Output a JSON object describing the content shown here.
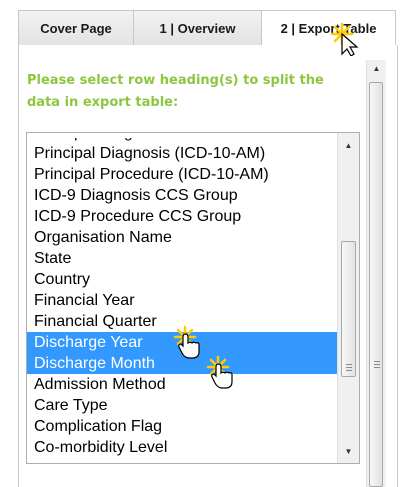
{
  "tabs": [
    {
      "label": "Cover Page"
    },
    {
      "label": "1 | Overview"
    },
    {
      "label": "2 | Export Table"
    }
  ],
  "prompt": "Please select row heading(s) to split the data in export table:",
  "list": {
    "items": [
      {
        "label": "Principal Diagnosis (ICD-10-AM)",
        "selected": false
      },
      {
        "label": "Principal Procedure (ICD-10-AM)",
        "selected": false
      },
      {
        "label": "ICD-9 Diagnosis CCS Group",
        "selected": false
      },
      {
        "label": "ICD-9 Procedure CCS Group",
        "selected": false
      },
      {
        "label": "Organisation Name",
        "selected": false
      },
      {
        "label": "State",
        "selected": false
      },
      {
        "label": "Country",
        "selected": false
      },
      {
        "label": "Financial Year",
        "selected": false
      },
      {
        "label": "Financial Quarter",
        "selected": false
      },
      {
        "label": "Discharge Year",
        "selected": true
      },
      {
        "label": "Discharge Month",
        "selected": true
      },
      {
        "label": "Admission Method",
        "selected": false
      },
      {
        "label": "Care Type",
        "selected": false
      },
      {
        "label": "Complication Flag",
        "selected": false
      },
      {
        "label": "Co-morbidity Level",
        "selected": false
      }
    ]
  },
  "colors": {
    "prompt_text": "#8dc63f",
    "selection_bg": "#3399ff",
    "click_highlight": "#ffcc00"
  },
  "icons": {
    "arrow_cursor": "arrow-cursor-icon",
    "hand_cursor": "hand-pointer-icon"
  }
}
